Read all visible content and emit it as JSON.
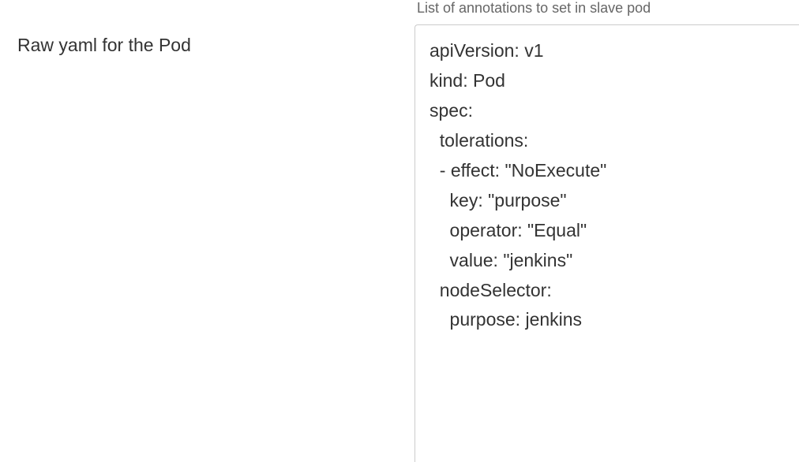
{
  "form": {
    "annotations_help": "List of annotations to set in slave pod",
    "yaml_label": "Raw yaml for the Pod",
    "yaml_value": "apiVersion: v1\nkind: Pod\nspec:\n  tolerations:\n  - effect: \"NoExecute\"\n    key: \"purpose\"\n    operator: \"Equal\"\n    value: \"jenkins\"\n  nodeSelector:\n    purpose: jenkins"
  }
}
